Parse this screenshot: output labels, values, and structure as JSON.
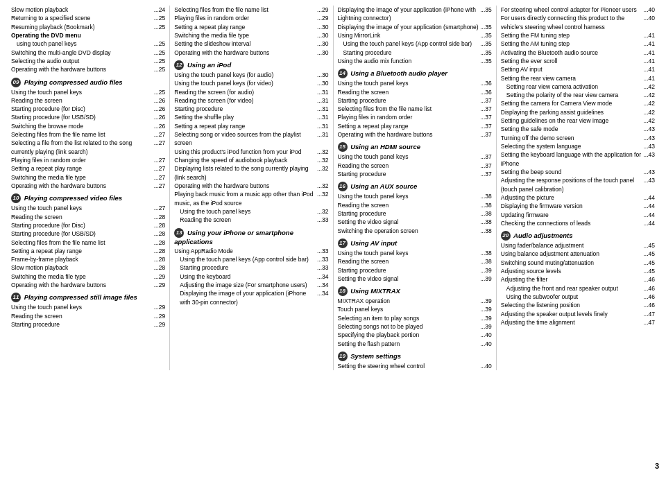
{
  "columns": [
    {
      "id": "col1",
      "entries": [
        {
          "title": "Slow motion playback",
          "dots": "...",
          "page": "24",
          "indent": 0
        },
        {
          "title": "Returning to a specified scene",
          "dots": "...",
          "page": "25",
          "indent": 0
        },
        {
          "title": "Resuming playback (Bookmark)",
          "dots": "...",
          "page": "25",
          "indent": 0
        },
        {
          "title": "Operating the DVD menu",
          "dots": "",
          "page": "",
          "indent": 0,
          "bold": true
        },
        {
          "title": "using touch panel keys",
          "dots": "...",
          "page": "25",
          "indent": 1
        },
        {
          "title": "Switching the multi-angle DVD display",
          "dots": "...",
          "page": "25",
          "indent": 0
        },
        {
          "title": "Selecting the audio output",
          "dots": "...",
          "page": "25",
          "indent": 0
        },
        {
          "title": "Operating with the hardware buttons",
          "dots": "...",
          "page": "25",
          "indent": 0
        },
        {
          "section": true,
          "num": "09",
          "title": "Playing compressed audio files"
        },
        {
          "title": "Using the touch panel keys",
          "dots": "...",
          "page": "25",
          "indent": 0
        },
        {
          "title": "Reading the screen",
          "dots": "...",
          "page": "26",
          "indent": 0
        },
        {
          "title": "Starting procedure (for Disc)",
          "dots": "...",
          "page": "26",
          "indent": 0
        },
        {
          "title": "Starting procedure (for USB/SD)",
          "dots": "...",
          "page": "26",
          "indent": 0
        },
        {
          "title": "Switching the browse mode",
          "dots": "...",
          "page": "26",
          "indent": 0
        },
        {
          "title": "Selecting files from the file name list",
          "dots": "...",
          "page": "27",
          "indent": 0
        },
        {
          "title": "Selecting a file from the list related to the song currently playing (link search)",
          "dots": "...",
          "page": "27",
          "indent": 0
        },
        {
          "title": "Playing files in random order",
          "dots": "...",
          "page": "27",
          "indent": 0
        },
        {
          "title": "Setting a repeat play range",
          "dots": "...",
          "page": "27",
          "indent": 0
        },
        {
          "title": "Switching the media file type",
          "dots": "...",
          "page": "27",
          "indent": 0
        },
        {
          "title": "Operating with the hardware buttons",
          "dots": "...",
          "page": "27",
          "indent": 0
        },
        {
          "section": true,
          "num": "10",
          "title": "Playing compressed video files"
        },
        {
          "title": "Using the touch panel keys",
          "dots": "...",
          "page": "27",
          "indent": 0
        },
        {
          "title": "Reading the screen",
          "dots": "...",
          "page": "28",
          "indent": 0
        },
        {
          "title": "Starting procedure (for Disc)",
          "dots": "...",
          "page": "28",
          "indent": 0
        },
        {
          "title": "Starting procedure (for USB/SD)",
          "dots": "...",
          "page": "28",
          "indent": 0
        },
        {
          "title": "Selecting files from the file name list",
          "dots": "...",
          "page": "28",
          "indent": 0
        },
        {
          "title": "Setting a repeat play range",
          "dots": "...",
          "page": "28",
          "indent": 0
        },
        {
          "title": "Frame-by-frame playback",
          "dots": "...",
          "page": "28",
          "indent": 0
        },
        {
          "title": "Slow motion playback",
          "dots": "...",
          "page": "28",
          "indent": 0
        },
        {
          "title": "Switching the media file type",
          "dots": "...",
          "page": "29",
          "indent": 0
        },
        {
          "title": "Operating with the hardware buttons",
          "dots": "...",
          "page": "29",
          "indent": 0
        },
        {
          "section": true,
          "num": "11",
          "title": "Playing compressed still image files"
        },
        {
          "title": "Using the touch panel keys",
          "dots": "...",
          "page": "29",
          "indent": 0
        },
        {
          "title": "Reading the screen",
          "dots": "...",
          "page": "29",
          "indent": 0
        },
        {
          "title": "Starting procedure",
          "dots": "...",
          "page": "29",
          "indent": 0
        }
      ]
    },
    {
      "id": "col2",
      "entries": [
        {
          "title": "Selecting files from the file name list",
          "dots": "...",
          "page": "29",
          "indent": 0
        },
        {
          "title": "Playing files in random order",
          "dots": "...",
          "page": "29",
          "indent": 0
        },
        {
          "title": "Setting a repeat play range",
          "dots": "...",
          "page": "30",
          "indent": 0
        },
        {
          "title": "Switching the media file type",
          "dots": "...",
          "page": "30",
          "indent": 0
        },
        {
          "title": "Setting the slideshow interval",
          "dots": "...",
          "page": "30",
          "indent": 0
        },
        {
          "title": "Operating with the hardware buttons",
          "dots": "...",
          "page": "30",
          "indent": 0
        },
        {
          "section": true,
          "num": "12",
          "title": "Using an iPod"
        },
        {
          "title": "Using the touch panel keys (for audio)",
          "dots": "...",
          "page": "30",
          "indent": 0
        },
        {
          "title": "Using the touch panel keys (for video)",
          "dots": "...",
          "page": "30",
          "indent": 0
        },
        {
          "title": "Reading the screen (for audio)",
          "dots": "...",
          "page": "31",
          "indent": 0
        },
        {
          "title": "Reading the screen (for video)",
          "dots": "...",
          "page": "31",
          "indent": 0
        },
        {
          "title": "Starting procedure",
          "dots": "...",
          "page": "31",
          "indent": 0
        },
        {
          "title": "Setting the shuffle play",
          "dots": "...",
          "page": "31",
          "indent": 0
        },
        {
          "title": "Setting a repeat play range",
          "dots": "...",
          "page": "31",
          "indent": 0
        },
        {
          "title": "Selecting song or video sources from the playlist screen",
          "dots": "...",
          "page": "31",
          "indent": 0
        },
        {
          "title": "Using this product’s iPod function from your iPod",
          "dots": "...",
          "page": "32",
          "indent": 0
        },
        {
          "title": "Changing the speed of audiobook playback",
          "dots": "...",
          "page": "32",
          "indent": 0
        },
        {
          "title": "Displaying lists related to the song currently playing (link search)",
          "dots": "...",
          "page": "32",
          "indent": 0
        },
        {
          "title": "Operating with the hardware buttons",
          "dots": "...",
          "page": "32",
          "indent": 0
        },
        {
          "title": "Playing back music from a music app other than iPod music, as the iPod source",
          "dots": "...",
          "page": "32",
          "indent": 0
        },
        {
          "title": "Using the touch panel keys",
          "dots": "...",
          "page": "32",
          "indent": 1
        },
        {
          "title": "Reading the screen",
          "dots": "...",
          "page": "33",
          "indent": 1
        },
        {
          "section": true,
          "num": "13",
          "title": "Using your iPhone or smartphone applications"
        },
        {
          "title": "Using AppRadio Mode",
          "dots": "...",
          "page": "33",
          "indent": 0
        },
        {
          "title": "Using the touch panel keys (App control side bar)",
          "dots": "...",
          "page": "33",
          "indent": 1
        },
        {
          "title": "Starting procedure",
          "dots": "...",
          "page": "33",
          "indent": 1
        },
        {
          "title": "Using the keyboard",
          "dots": "...",
          "page": "34",
          "indent": 1
        },
        {
          "title": "Adjusting the image size (For smartphone users)",
          "dots": "...",
          "page": "34",
          "indent": 1
        },
        {
          "title": "Displaying the image of your application (iPhone with 30-pin connector)",
          "dots": "...",
          "page": "34",
          "indent": 1
        }
      ]
    },
    {
      "id": "col3",
      "entries": [
        {
          "title": "Displaying the image of your application (iPhone with Lightning connector)",
          "dots": "...",
          "page": "35",
          "indent": 0
        },
        {
          "title": "Displaying the image of your application (smartphone)",
          "dots": "...",
          "page": "35",
          "indent": 0
        },
        {
          "title": "Using MirrorLink",
          "dots": "...",
          "page": "35",
          "indent": 0
        },
        {
          "title": "Using the touch panel keys (App control side bar)",
          "dots": "...",
          "page": "35",
          "indent": 1
        },
        {
          "title": "Starting procedure",
          "dots": "...",
          "page": "35",
          "indent": 1
        },
        {
          "title": "Using the audio mix function",
          "dots": "...",
          "page": "35",
          "indent": 0
        },
        {
          "section": true,
          "num": "14",
          "title": "Using a Bluetooth audio player"
        },
        {
          "title": "Using the touch panel keys",
          "dots": "...",
          "page": "36",
          "indent": 0
        },
        {
          "title": "Reading the screen",
          "dots": "...",
          "page": "36",
          "indent": 0
        },
        {
          "title": "Starting procedure",
          "dots": "...",
          "page": "37",
          "indent": 0
        },
        {
          "title": "Selecting files from the file name list",
          "dots": "...",
          "page": "37",
          "indent": 0
        },
        {
          "title": "Playing files in random order",
          "dots": "...",
          "page": "37",
          "indent": 0
        },
        {
          "title": "Setting a repeat play range",
          "dots": "...",
          "page": "37",
          "indent": 0
        },
        {
          "title": "Operating with the hardware buttons",
          "dots": "...",
          "page": "37",
          "indent": 0
        },
        {
          "section": true,
          "num": "15",
          "title": "Using an HDMI source"
        },
        {
          "title": "Using the touch panel keys",
          "dots": "...",
          "page": "37",
          "indent": 0
        },
        {
          "title": "Reading the screen",
          "dots": "...",
          "page": "37",
          "indent": 0
        },
        {
          "title": "Starting procedure",
          "dots": "...",
          "page": "37",
          "indent": 0
        },
        {
          "section": true,
          "num": "16",
          "title": "Using an AUX source"
        },
        {
          "title": "Using the touch panel keys",
          "dots": "...",
          "page": "38",
          "indent": 0
        },
        {
          "title": "Reading the screen",
          "dots": "...",
          "page": "38",
          "indent": 0
        },
        {
          "title": "Starting procedure",
          "dots": "...",
          "page": "38",
          "indent": 0
        },
        {
          "title": "Setting the video signal",
          "dots": "...",
          "page": "38",
          "indent": 0
        },
        {
          "title": "Switching the operation screen",
          "dots": "...",
          "page": "38",
          "indent": 0
        },
        {
          "section": true,
          "num": "17",
          "title": "Using AV input"
        },
        {
          "title": "Using the touch panel keys",
          "dots": "...",
          "page": "38",
          "indent": 0
        },
        {
          "title": "Reading the screen",
          "dots": "...",
          "page": "38",
          "indent": 0
        },
        {
          "title": "Starting procedure",
          "dots": "...",
          "page": "39",
          "indent": 0
        },
        {
          "title": "Setting the video signal",
          "dots": "...",
          "page": "39",
          "indent": 0
        },
        {
          "section": true,
          "num": "18",
          "title": "Using MIXTRAX"
        },
        {
          "title": "MIXTRAX operation",
          "dots": "...",
          "page": "39",
          "indent": 0
        },
        {
          "title": "Touch panel keys",
          "dots": "...",
          "page": "39",
          "indent": 0
        },
        {
          "title": "Selecting an item to play songs",
          "dots": "...",
          "page": "39",
          "indent": 0
        },
        {
          "title": "Selecting songs not to be played",
          "dots": "...",
          "page": "39",
          "indent": 0
        },
        {
          "title": "Specifying the playback portion",
          "dots": "...",
          "page": "40",
          "indent": 0
        },
        {
          "title": "Setting the flash pattern",
          "dots": "...",
          "page": "40",
          "indent": 0
        },
        {
          "section": true,
          "num": "19",
          "title": "System settings"
        },
        {
          "title": "Setting the steering wheel control",
          "dots": "...",
          "page": "40",
          "indent": 0
        }
      ]
    },
    {
      "id": "col4",
      "entries": [
        {
          "title": "For steering wheel control adapter for Pioneer users",
          "dots": "...",
          "page": "40",
          "indent": 0
        },
        {
          "title": "For users directly connecting this product to the vehicle’s steering wheel control harness",
          "dots": "...",
          "page": "40",
          "indent": 0
        },
        {
          "title": "Setting the FM tuning step",
          "dots": "...",
          "page": "41",
          "indent": 0
        },
        {
          "title": "Setting the AM tuning step",
          "dots": "...",
          "page": "41",
          "indent": 0
        },
        {
          "title": "Activating the Bluetooth audio source",
          "dots": "...",
          "page": "41",
          "indent": 0
        },
        {
          "title": "Setting the ever scroll",
          "dots": "...",
          "page": "41",
          "indent": 0
        },
        {
          "title": "Setting AV input",
          "dots": "...",
          "page": "41",
          "indent": 0
        },
        {
          "title": "Setting the rear view camera",
          "dots": "...",
          "page": "41",
          "indent": 0
        },
        {
          "title": "Setting rear view camera activation",
          "dots": "...",
          "page": "42",
          "indent": 1
        },
        {
          "title": "Setting the polarity of the rear view camera",
          "dots": "...",
          "page": "42",
          "indent": 1
        },
        {
          "title": "Setting the camera for Camera View mode",
          "dots": "...",
          "page": "42",
          "indent": 0
        },
        {
          "title": "Displaying the parking assist guidelines",
          "dots": "...",
          "page": "42",
          "indent": 0
        },
        {
          "title": "Setting guidelines on the rear view image",
          "dots": "...",
          "page": "42",
          "indent": 0
        },
        {
          "title": "Setting the safe mode",
          "dots": "...",
          "page": "43",
          "indent": 0
        },
        {
          "title": "Turning off the demo screen",
          "dots": "...",
          "page": "43",
          "indent": 0
        },
        {
          "title": "Selecting the system language",
          "dots": "...",
          "page": "43",
          "indent": 0
        },
        {
          "title": "Setting the keyboard language with the application for iPhone",
          "dots": "...",
          "page": "43",
          "indent": 0
        },
        {
          "title": "Setting the beep sound",
          "dots": "...",
          "page": "43",
          "indent": 0
        },
        {
          "title": "Adjusting the response positions of the touch panel (touch panel calibration)",
          "dots": "...",
          "page": "43",
          "indent": 0
        },
        {
          "title": "Adjusting the picture",
          "dots": "...",
          "page": "44",
          "indent": 0
        },
        {
          "title": "Displaying the firmware version",
          "dots": "...",
          "page": "44",
          "indent": 0
        },
        {
          "title": "Updating firmware",
          "dots": "...",
          "page": "44",
          "indent": 0
        },
        {
          "title": "Checking the connections of leads",
          "dots": "...",
          "page": "44",
          "indent": 0
        },
        {
          "section": true,
          "num": "20",
          "title": "Audio adjustments"
        },
        {
          "title": "Using fader/balance adjustment",
          "dots": "...",
          "page": "45",
          "indent": 0
        },
        {
          "title": "Using balance adjustment attenuation",
          "dots": "...",
          "page": "45",
          "indent": 0
        },
        {
          "title": "Switching sound muting/attenuation",
          "dots": "...",
          "page": "45",
          "indent": 0
        },
        {
          "title": "Adjusting source levels",
          "dots": "...",
          "page": "45",
          "indent": 0
        },
        {
          "title": "Adjusting the filter",
          "dots": "...",
          "page": "46",
          "indent": 0
        },
        {
          "title": "Adjusting the front and rear speaker output",
          "dots": "...",
          "page": "46",
          "indent": 1
        },
        {
          "title": "Using the subwoofer output",
          "dots": "...",
          "page": "46",
          "indent": 1
        },
        {
          "title": "Selecting the listening position",
          "dots": "...",
          "page": "46",
          "indent": 0
        },
        {
          "title": "Adjusting the speaker output levels finely",
          "dots": "...",
          "page": "47",
          "indent": 0
        },
        {
          "title": "Adjusting the time alignment",
          "dots": "...",
          "page": "47",
          "indent": 0
        }
      ]
    }
  ],
  "page_corner": "3"
}
